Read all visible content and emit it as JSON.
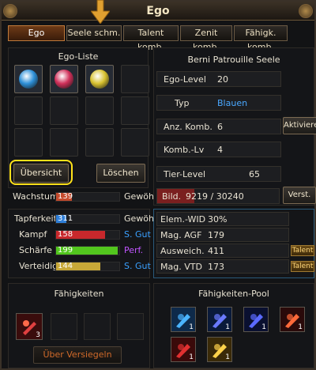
{
  "window": {
    "title": "Ego"
  },
  "tabs": [
    "Ego",
    "Seele schm.",
    "Talent komb.",
    "Zenit komb.",
    "Fähigk. komb."
  ],
  "ego_list": {
    "title": "Ego-Liste",
    "gems": [
      {
        "name": "blue-ego-gem",
        "color": "#2e90d8"
      },
      {
        "name": "red-ego-gem",
        "color": "#d0305a"
      },
      {
        "name": "yellow-ego-gem",
        "color": "#d8c230"
      }
    ]
  },
  "buttons": {
    "overview": "Übersicht",
    "delete": "Löschen",
    "activate": "Aktiviere",
    "verst": "Verst.",
    "unseal": "Über Versiegeln"
  },
  "growth": {
    "label": "Wachstum",
    "value": "139",
    "fill": 0.25,
    "grade": "Gewöh."
  },
  "stats": [
    {
      "label": "Tapferkeit",
      "value": "311",
      "fill": 0.16,
      "color": "#2e7ed8",
      "grade": "Gewöh.",
      "grade_color": "#e8e2d2"
    },
    {
      "label": "Kampf",
      "value": "158",
      "fill": 0.78,
      "color": "#c8282c",
      "grade": "S. Gut",
      "grade_color": "#3aa0ff"
    },
    {
      "label": "Schärfe",
      "value": "199",
      "fill": 0.98,
      "color": "#52c61e",
      "grade": "Perf.",
      "grade_color": "#c055ff"
    },
    {
      "label": "Verteidig.",
      "value": "144",
      "fill": 0.7,
      "color": "#c8a838",
      "grade": "S. Gut",
      "grade_color": "#3aa0ff"
    }
  ],
  "soul": {
    "name": "Berni Patrouille Seele",
    "ego_level_label": "Ego-Level",
    "ego_level": "20",
    "type_label": "Typ",
    "type": "Blauen",
    "comb_label": "Anz. Komb.",
    "comb": "6",
    "comb_lv_label": "Komb.-Lv",
    "comb_lv": "4",
    "tier_label": "Tier-Level",
    "tier": "65",
    "image_label": "Bild.",
    "image_value": "9219",
    "image_max": "30240",
    "image_text": "9219 / 30240"
  },
  "attributes": [
    {
      "label": "Elem.-WID",
      "value": "30%"
    },
    {
      "label": "Mag. AGF",
      "value": "179"
    },
    {
      "label": "Ausweich.",
      "value": "411",
      "talent": "Talent"
    },
    {
      "label": "Mag. VTD",
      "value": "173",
      "talent": "Talent"
    }
  ],
  "abilities": {
    "title": "Fähigkeiten",
    "first_count": "3"
  },
  "pool": {
    "title": "Fähigkeiten-Pool",
    "counts": [
      "1",
      "1",
      "1",
      "1",
      "1",
      "1"
    ]
  },
  "colors": {
    "accent": "#ffe21a",
    "type_blue": "#4aa8ff",
    "gold": "#d8c230"
  }
}
